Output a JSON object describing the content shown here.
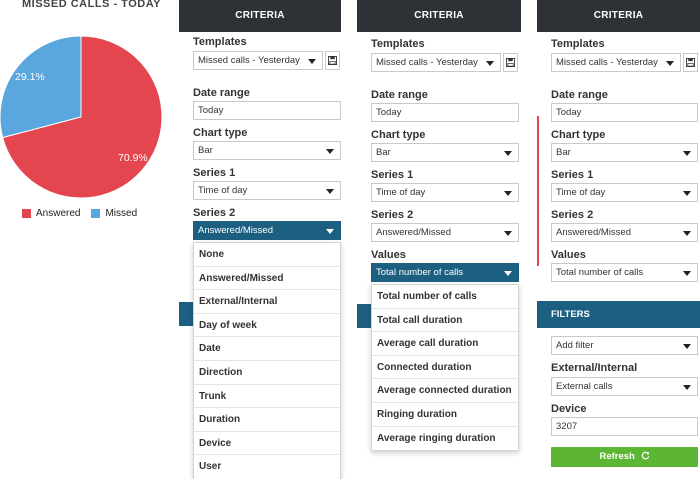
{
  "left": {
    "title": "MISSED CALLS - TODAY",
    "pie_labels": [
      "70.9%",
      "29.1%"
    ],
    "legend": [
      "Answered",
      "Missed"
    ]
  },
  "chart_data": {
    "type": "pie",
    "title": "MISSED CALLS - TODAY",
    "categories": [
      "Answered",
      "Missed"
    ],
    "values": [
      70.9,
      29.1
    ],
    "colors": [
      "#e4464f",
      "#5aa6de"
    ],
    "labels": [
      "70.9%",
      "29.1%"
    ],
    "legend_position": "bottom"
  },
  "panel1": {
    "header": "CRITERIA",
    "templates_label": "Templates",
    "templates_value": "Missed calls - Yesterday",
    "date_range_label": "Date range",
    "date_range_value": "Today",
    "chart_type_label": "Chart type",
    "chart_type_value": "Bar",
    "series1_label": "Series 1",
    "series1_value": "Time of day",
    "series2_label": "Series 2",
    "series2_value": "Answered/Missed",
    "series2_options": [
      "None",
      "Answered/Missed",
      "External/Internal",
      "Day of week",
      "Date",
      "Direction",
      "Trunk",
      "Duration",
      "Device",
      "User"
    ]
  },
  "panel2": {
    "header": "CRITERIA",
    "templates_label": "Templates",
    "templates_value": "Missed calls - Yesterday",
    "date_range_label": "Date range",
    "date_range_value": "Today",
    "chart_type_label": "Chart type",
    "chart_type_value": "Bar",
    "series1_label": "Series 1",
    "series1_value": "Time of day",
    "series2_label": "Series 2",
    "series2_value": "Answered/Missed",
    "values_label": "Values",
    "values_value": "Total number of calls",
    "values_options": [
      "Total number of calls",
      "Total call duration",
      "Average call duration",
      "Connected duration",
      "Average connected duration",
      "Ringing duration",
      "Average ringing duration"
    ]
  },
  "panel3": {
    "header": "CRITERIA",
    "templates_label": "Templates",
    "templates_value": "Missed calls - Yesterday",
    "date_range_label": "Date range",
    "date_range_value": "Today",
    "chart_type_label": "Chart type",
    "chart_type_value": "Bar",
    "series1_label": "Series 1",
    "series1_value": "Time of day",
    "series2_label": "Series 2",
    "series2_value": "Answered/Missed",
    "values_label": "Values",
    "values_value": "Total number of calls",
    "filters_header": "FILTERS",
    "add_filter_value": "Add filter",
    "ext_int_label": "External/Internal",
    "ext_int_value": "External calls",
    "device_label": "Device",
    "device_value": "3207",
    "refresh_label": "Refresh"
  },
  "colors": {
    "header_dark": "#2e3237",
    "accent_blue": "#1d5f80",
    "refresh_green": "#5cb533",
    "answered_red": "#e4464f",
    "missed_blue": "#5aa6de"
  }
}
